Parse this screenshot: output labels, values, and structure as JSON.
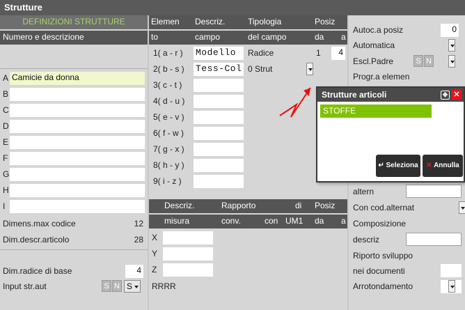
{
  "window": {
    "title": "Strutture"
  },
  "left": {
    "header": "DEFINIZIONI STRUTTURE",
    "subheader": "Numero e descrizione",
    "rows": [
      {
        "letter": "A",
        "value": "Camicie da donna"
      },
      {
        "letter": "B",
        "value": ""
      },
      {
        "letter": "C",
        "value": ""
      },
      {
        "letter": "D",
        "value": ""
      },
      {
        "letter": "E",
        "value": ""
      },
      {
        "letter": "F",
        "value": ""
      },
      {
        "letter": "G",
        "value": ""
      },
      {
        "letter": "H",
        "value": ""
      },
      {
        "letter": "I",
        "value": ""
      }
    ],
    "dimens_label": "Dimens.max codice",
    "dimens_value": "12",
    "dimdescr_label": "Dim.descr.articolo",
    "dimdescr_value": "28",
    "dimradice_label": "Dim.radice di base",
    "dimradice_value": "4",
    "input_label": "Input str.aut",
    "s": "S",
    "n": "N",
    "selected": "S"
  },
  "middle": {
    "h1": {
      "elem": "Elemen",
      "descr": "Descriz.",
      "tipo": "Tipologia",
      "posiz": "Posiz"
    },
    "h2": {
      "elem": "to",
      "descr": "campo",
      "tipo": "del campo",
      "da": "da",
      "a": "a"
    },
    "elements": [
      {
        "code": "1( a - r )",
        "descr": "Modello",
        "tipo": "Radice",
        "da": "1",
        "a": "4"
      },
      {
        "code": "2( b - s )",
        "descr": "Tess-Col",
        "tipo": "0 Strut",
        "da": "",
        "a": ""
      },
      {
        "code": "3( c - t )",
        "descr": "",
        "tipo": "",
        "da": "",
        "a": ""
      },
      {
        "code": "4( d - u )",
        "descr": "",
        "tipo": "",
        "da": "",
        "a": ""
      },
      {
        "code": "5( e - v )",
        "descr": "",
        "tipo": "",
        "da": "",
        "a": ""
      },
      {
        "code": "6( f - w )",
        "descr": "",
        "tipo": "",
        "da": "",
        "a": ""
      },
      {
        "code": "7( g - x )",
        "descr": "",
        "tipo": "",
        "da": "",
        "a": ""
      },
      {
        "code": "8( h - y )",
        "descr": "",
        "tipo": "",
        "da": "",
        "a": ""
      },
      {
        "code": "9( i - z )",
        "descr": "",
        "tipo": "",
        "da": "",
        "a": ""
      }
    ],
    "m1": {
      "descr": "Descriz.",
      "rapporto": "Rapporto",
      "di": "di",
      "posiz": "Posiz"
    },
    "m2": {
      "misura": "misura",
      "conv": "conv.",
      "con": "con",
      "um1": "UM1",
      "da": "da",
      "a": "a"
    },
    "xyz": [
      "X",
      "Y",
      "Z"
    ],
    "rrrr": "RRRR"
  },
  "right": {
    "autoc_label": "Autoc.a posiz",
    "autoc_value": "0",
    "automatica_label": "Automatica",
    "escl_label": "Escl.Padre",
    "s": "S",
    "n": "N",
    "progr_label": "Progr.a elemen",
    "altern_label": "altern",
    "concod_label": "Con cod.alternat",
    "composizione_label": "Composizione",
    "descriz_label": "descriz",
    "riporto_label": "Riporto sviluppo",
    "neidoc_label": "nei documenti",
    "arrot_label": "Arrotondamento"
  },
  "popup": {
    "title": "Strutture articoli",
    "items": [
      "STOFFE"
    ],
    "select_label": "Seleziona",
    "cancel_label": "Annulla"
  },
  "colors": {
    "titlebar": "#5a5a5a",
    "header": "#555555",
    "highlight": "#f2f7cc",
    "popup_selected": "#7fc200",
    "close": "#e8141c",
    "arrow": "#e81010"
  }
}
